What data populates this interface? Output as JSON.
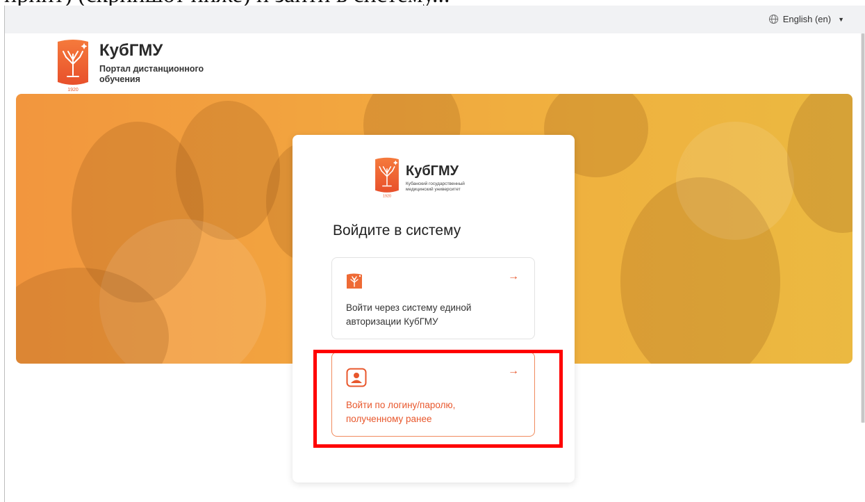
{
  "document_fragment": "принт) (скриншот ниже) и зайти в систему...",
  "header": {
    "language": "English (en)",
    "brand_name": "КубГМУ",
    "brand_subtitle": "Портал дистанционного обучения",
    "logo_year": "1920"
  },
  "card": {
    "brand_name": "КубГМУ",
    "brand_subtitle": "Кубанский государственный медицинский университет",
    "logo_year": "1920",
    "title": "Войдите в систему",
    "options": [
      {
        "label": "Войти через систему единой авторизации КубГМУ",
        "icon": "kubgmu-logo-icon",
        "arrow": "→"
      },
      {
        "label": "Войти по логину/паролю, полученному ранее",
        "icon": "user-icon",
        "arrow": "→"
      }
    ]
  },
  "colors": {
    "accent": "#e8572c",
    "hero_start": "#f2963e",
    "hero_end": "#ebb941",
    "highlight": "#ff0000"
  }
}
